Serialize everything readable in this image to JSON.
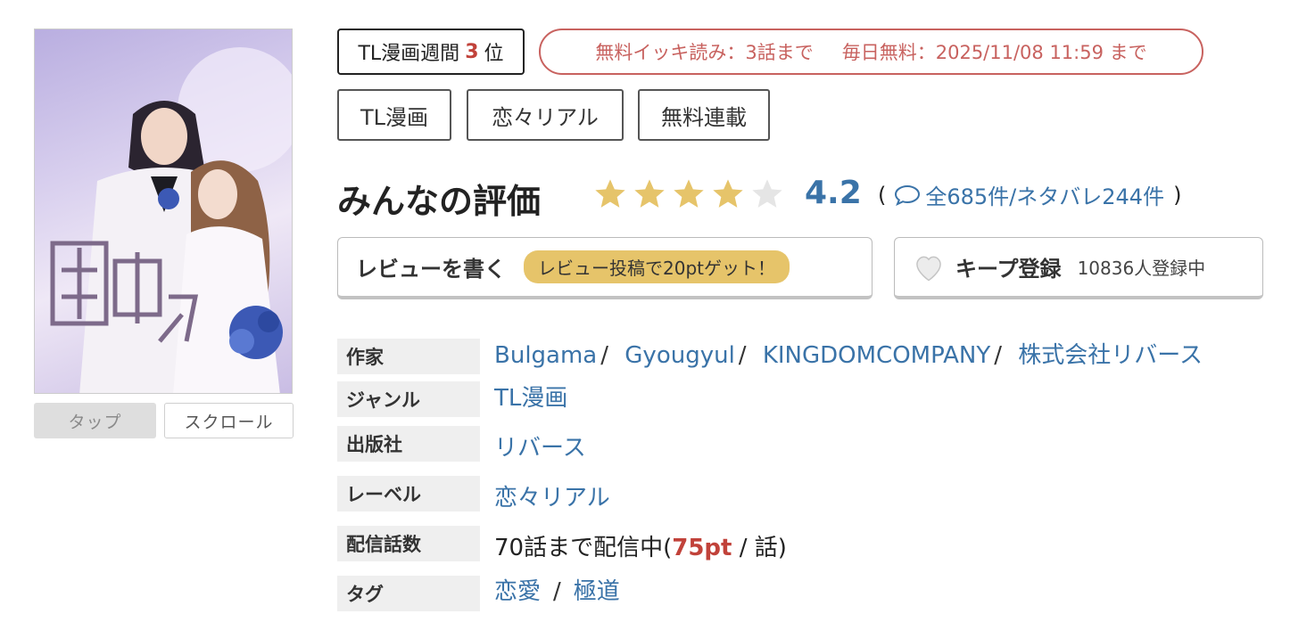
{
  "cover": {
    "buttons": {
      "tap": "タップ",
      "scroll": "スクロール"
    }
  },
  "ranking": {
    "prefix": "TL漫画週間",
    "rank": "3",
    "suffix": "位"
  },
  "free_info": {
    "binge": "無料イッキ読み：3話まで",
    "daily": "毎日無料：2025/11/08 11:59 まで"
  },
  "genre_tags": [
    "TL漫画",
    "恋々リアル",
    "無料連載"
  ],
  "rating": {
    "title": "みんなの評価",
    "score": "4.2",
    "stars_filled": 4,
    "stars_total": 5,
    "open_paren": "(",
    "reviews": "全685件/ネタバレ244件",
    "close_paren": ")"
  },
  "review_button": {
    "label": "レビューを書く",
    "promo": "レビュー投稿で20ptゲット！"
  },
  "keep_button": {
    "label": "キープ登録",
    "count": "10836人登録中"
  },
  "info": {
    "author_label": "作家",
    "authors": [
      "Bulgama",
      "Gyougyul",
      "KINGDOMCOMPANY",
      "株式会社リバース"
    ],
    "genre_label": "ジャンル",
    "genre": "TL漫画",
    "publisher_label": "出版社",
    "publisher": "リバース",
    "label_label": "レーベル",
    "label": "恋々リアル",
    "episodes_label": "配信話数",
    "episodes_prefix": "70話まで配信中(",
    "episodes_price": "75pt",
    "episodes_suffix": " / 話)",
    "tags_label": "タグ",
    "tags": [
      "恋愛",
      "極道"
    ],
    "separator": "/"
  },
  "colors": {
    "accent_red": "#c1423a",
    "free_red": "#c8625f",
    "link_blue": "#3a73a8",
    "star_gold": "#e6c46a",
    "star_empty": "#e5e5e5",
    "label_bg": "#efefef"
  },
  "icons": {
    "stars": "star-icon",
    "comment": "speech-bubble-icon",
    "keep": "heart-icon"
  }
}
